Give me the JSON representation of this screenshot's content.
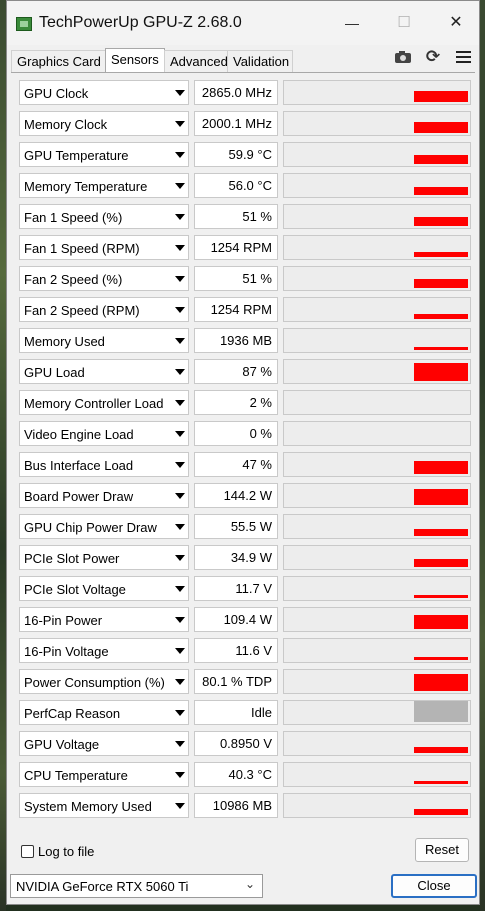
{
  "window": {
    "title": "TechPowerUp GPU-Z 2.68.0",
    "minimize": "—",
    "maximize": "☐",
    "close": "✕"
  },
  "tabs": [
    "Graphics Card",
    "Sensors",
    "Advanced",
    "Validation"
  ],
  "active_tab": "Sensors",
  "toolbar": {
    "camera_icon": "camera-icon",
    "refresh_icon": "refresh-icon",
    "refresh_glyph": "⟳",
    "menu_icon": "hamburger-menu-icon"
  },
  "graph_color": "#ff0000",
  "sensors": [
    {
      "name": "GPU Clock",
      "value": "2865.0 MHz",
      "level": 0.5
    },
    {
      "name": "Memory Clock",
      "value": "2000.1 MHz",
      "level": 0.5
    },
    {
      "name": "GPU Temperature",
      "value": "59.9 °C",
      "level": 0.45
    },
    {
      "name": "Memory Temperature",
      "value": "56.0 °C",
      "level": 0.4
    },
    {
      "name": "Fan 1 Speed (%)",
      "value": "51 %",
      "level": 0.45
    },
    {
      "name": "Fan 1 Speed (RPM)",
      "value": "1254 RPM",
      "level": 0.25
    },
    {
      "name": "Fan 2 Speed (%)",
      "value": "51 %",
      "level": 0.45
    },
    {
      "name": "Fan 2 Speed (RPM)",
      "value": "1254 RPM",
      "level": 0.25
    },
    {
      "name": "Memory Used",
      "value": "1936 MB",
      "level": 0.12
    },
    {
      "name": "GPU Load",
      "value": "87 %",
      "level": 0.87
    },
    {
      "name": "Memory Controller Load",
      "value": "2 %",
      "level": 0.0
    },
    {
      "name": "Video Engine Load",
      "value": "0 %",
      "level": 0.0
    },
    {
      "name": "Bus Interface Load",
      "value": "47 %",
      "level": 0.6
    },
    {
      "name": "Board Power Draw",
      "value": "144.2 W",
      "level": 0.75
    },
    {
      "name": "GPU Chip Power Draw",
      "value": "55.5 W",
      "level": 0.35
    },
    {
      "name": "PCIe Slot Power",
      "value": "34.9 W",
      "level": 0.4
    },
    {
      "name": "PCIe Slot Voltage",
      "value": "11.7 V",
      "level": 0.15
    },
    {
      "name": "16-Pin Power",
      "value": "109.4 W",
      "level": 0.65
    },
    {
      "name": "16-Pin Voltage",
      "value": "11.6 V",
      "level": 0.15
    },
    {
      "name": "Power Consumption (%)",
      "value": "80.1 % TDP",
      "level": 0.8
    },
    {
      "name": "PerfCap Reason",
      "value": "Idle",
      "level": 1.0,
      "color": "#b4b4b4"
    },
    {
      "name": "GPU Voltage",
      "value": "0.8950 V",
      "level": 0.3
    },
    {
      "name": "CPU Temperature",
      "value": "40.3 °C",
      "level": 0.15
    },
    {
      "name": "System Memory Used",
      "value": "10986 MB",
      "level": 0.3
    }
  ],
  "footer": {
    "log_to_file_label": "Log to file",
    "reset_label": "Reset",
    "gpu_name": "NVIDIA GeForce RTX 5060 Ti",
    "close_label": "Close"
  }
}
